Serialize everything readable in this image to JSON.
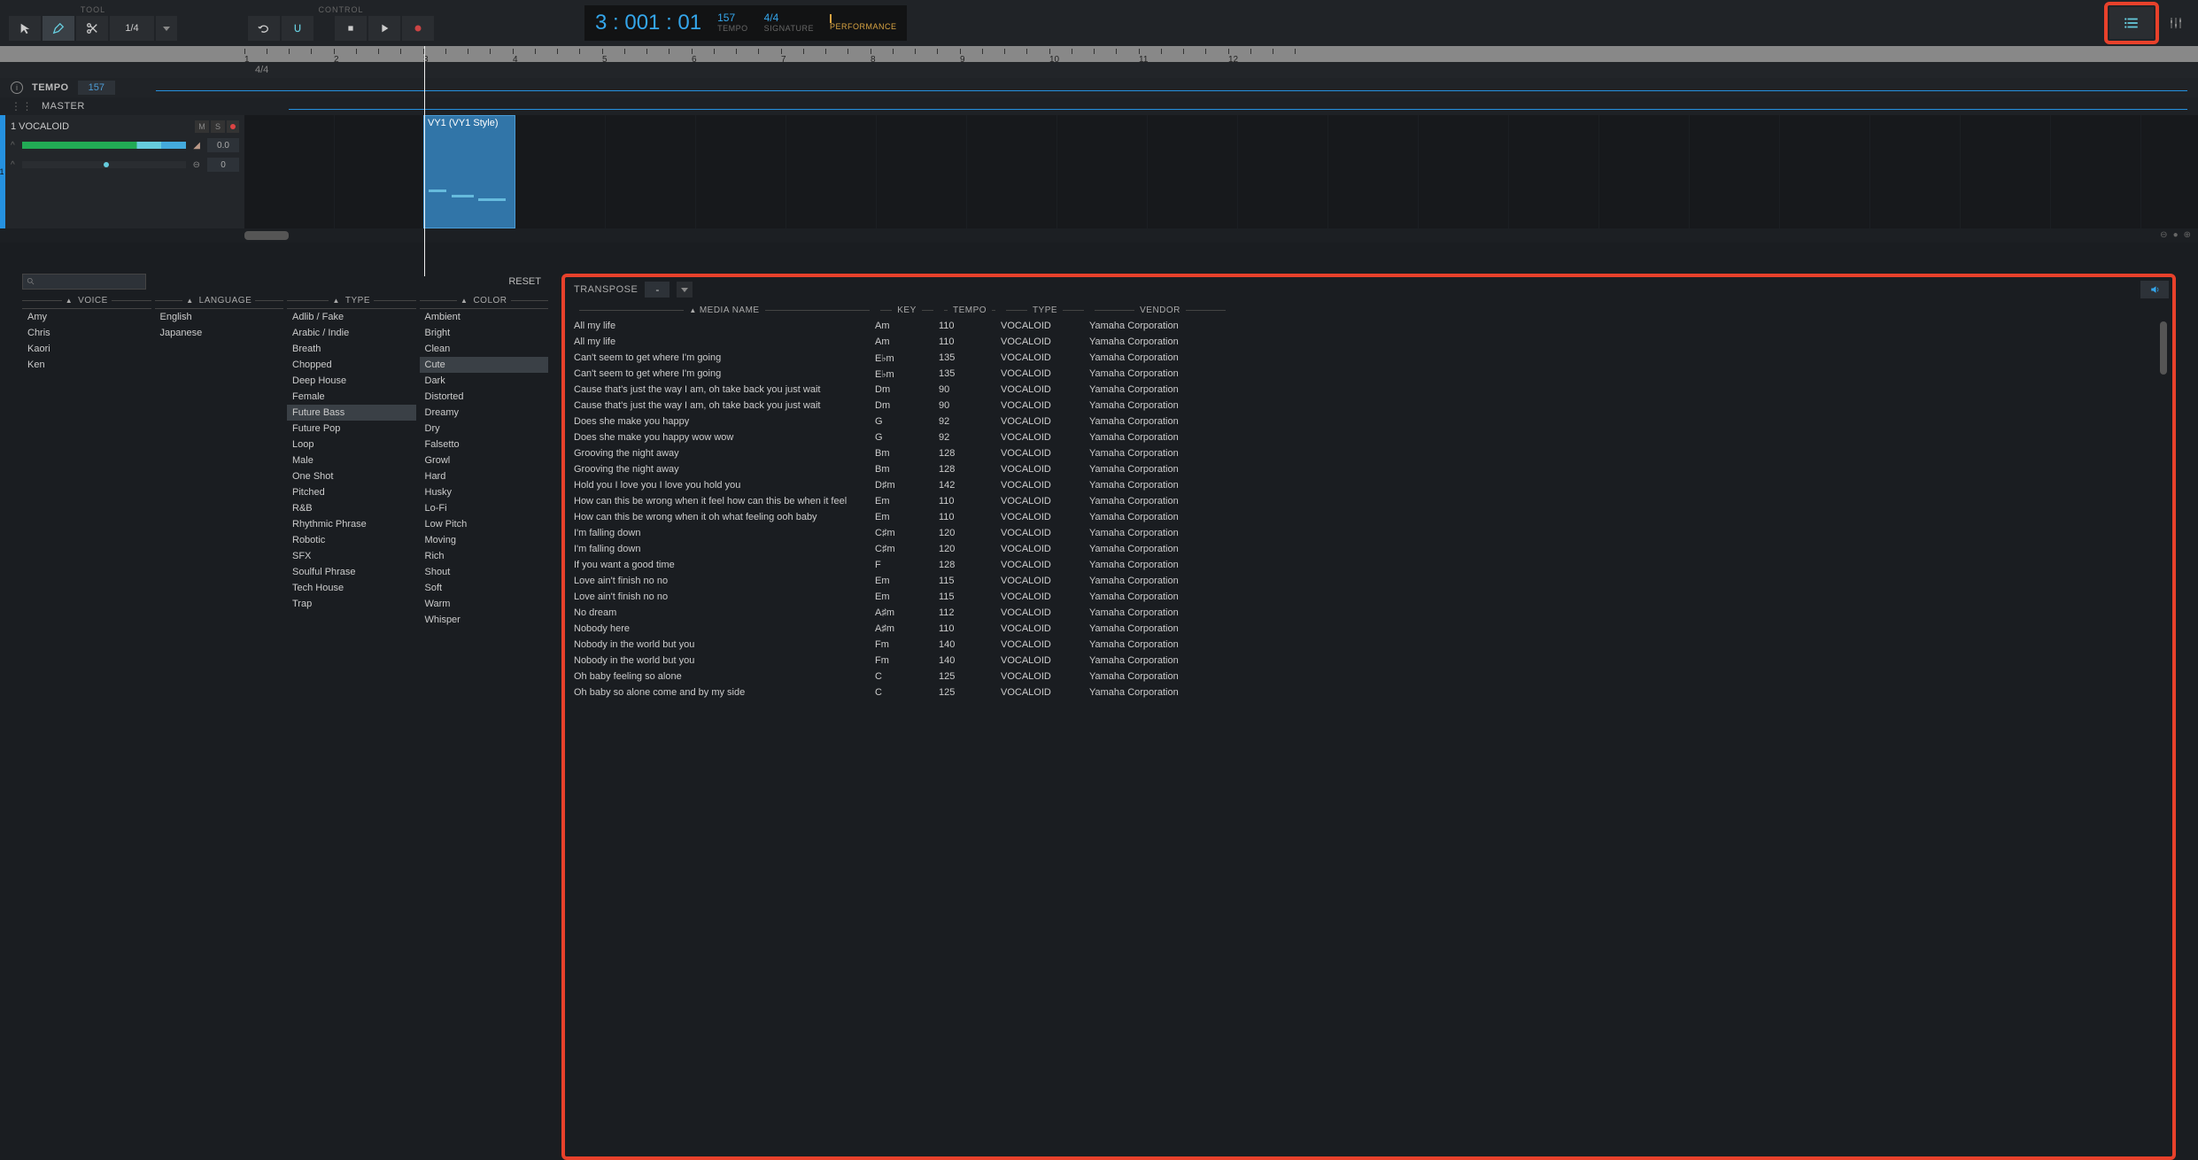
{
  "toolbar": {
    "tool_label": "TOOL",
    "control_label": "CONTROL",
    "fraction": "1/4"
  },
  "transport": {
    "time": "3 : 001 : 01",
    "tempo_val": "157",
    "tempo_label": "TEMPO",
    "sig_val": "4/4",
    "sig_label": "SIGNATURE",
    "perf_label": "PERFORMANCE"
  },
  "sig_row": "4/4",
  "tempo_row": {
    "label": "TEMPO",
    "value": "157"
  },
  "master_row": {
    "label": "MASTER"
  },
  "track": {
    "num": "1",
    "name": "1 VOCALOID",
    "m": "M",
    "s": "S",
    "vol": "0.0",
    "pan": "0",
    "clip_label": "VY1 (VY1 Style)"
  },
  "reset": "RESET",
  "filters": {
    "voice": {
      "header": "VOICE",
      "items": [
        "Amy",
        "Chris",
        "Kaori",
        "Ken"
      ]
    },
    "language": {
      "header": "LANGUAGE",
      "items": [
        "English",
        "Japanese"
      ]
    },
    "type": {
      "header": "TYPE",
      "items": [
        "Adlib / Fake",
        "Arabic / Indie",
        "Breath",
        "Chopped",
        "Deep House",
        "Female",
        "Future Bass",
        "Future Pop",
        "Loop",
        "Male",
        "One Shot",
        "Pitched",
        "R&B",
        "Rhythmic Phrase",
        "Robotic",
        "SFX",
        "Soulful Phrase",
        "Tech House",
        "Trap"
      ],
      "selected": "Future Bass"
    },
    "color": {
      "header": "COLOR",
      "items": [
        "Ambient",
        "Bright",
        "Clean",
        "Cute",
        "Dark",
        "Distorted",
        "Dreamy",
        "Dry",
        "Falsetto",
        "Growl",
        "Hard",
        "Husky",
        "Lo-Fi",
        "Low Pitch",
        "Moving",
        "Rich",
        "Shout",
        "Soft",
        "Warm",
        "Whisper"
      ],
      "selected": "Cute"
    }
  },
  "media": {
    "transpose_label": "TRANSPOSE",
    "transpose_val": "-",
    "headers": {
      "name": "MEDIA NAME",
      "key": "KEY",
      "tempo": "TEMPO",
      "type": "TYPE",
      "vendor": "VENDOR"
    },
    "rows": [
      {
        "name": "All my life",
        "key": "Am",
        "tempo": "110",
        "type": "VOCALOID",
        "vendor": "Yamaha Corporation"
      },
      {
        "name": "All my life",
        "key": "Am",
        "tempo": "110",
        "type": "VOCALOID",
        "vendor": "Yamaha Corporation"
      },
      {
        "name": "Can't seem to get where I'm going",
        "key": "E♭m",
        "tempo": "135",
        "type": "VOCALOID",
        "vendor": "Yamaha Corporation"
      },
      {
        "name": "Can't seem to get where I'm going",
        "key": "E♭m",
        "tempo": "135",
        "type": "VOCALOID",
        "vendor": "Yamaha Corporation"
      },
      {
        "name": "Cause that's just the way I am, oh take back you just wait",
        "key": "Dm",
        "tempo": "90",
        "type": "VOCALOID",
        "vendor": "Yamaha Corporation"
      },
      {
        "name": "Cause that's just the way I am, oh take back you just wait",
        "key": "Dm",
        "tempo": "90",
        "type": "VOCALOID",
        "vendor": "Yamaha Corporation"
      },
      {
        "name": "Does she make you happy",
        "key": "G",
        "tempo": "92",
        "type": "VOCALOID",
        "vendor": "Yamaha Corporation"
      },
      {
        "name": "Does she make you happy wow wow",
        "key": "G",
        "tempo": "92",
        "type": "VOCALOID",
        "vendor": "Yamaha Corporation"
      },
      {
        "name": "Grooving the night away",
        "key": "Bm",
        "tempo": "128",
        "type": "VOCALOID",
        "vendor": "Yamaha Corporation"
      },
      {
        "name": "Grooving the night away",
        "key": "Bm",
        "tempo": "128",
        "type": "VOCALOID",
        "vendor": "Yamaha Corporation"
      },
      {
        "name": "Hold you I love you I love you hold you",
        "key": "D♯m",
        "tempo": "142",
        "type": "VOCALOID",
        "vendor": "Yamaha Corporation"
      },
      {
        "name": "How can this be wrong when it feel how can this be when it feel",
        "key": "Em",
        "tempo": "110",
        "type": "VOCALOID",
        "vendor": "Yamaha Corporation"
      },
      {
        "name": "How can this be wrong when it oh what feeling ooh baby",
        "key": "Em",
        "tempo": "110",
        "type": "VOCALOID",
        "vendor": "Yamaha Corporation"
      },
      {
        "name": "I'm falling down",
        "key": "C♯m",
        "tempo": "120",
        "type": "VOCALOID",
        "vendor": "Yamaha Corporation"
      },
      {
        "name": "I'm falling down",
        "key": "C♯m",
        "tempo": "120",
        "type": "VOCALOID",
        "vendor": "Yamaha Corporation"
      },
      {
        "name": "If you want a good time",
        "key": "F",
        "tempo": "128",
        "type": "VOCALOID",
        "vendor": "Yamaha Corporation"
      },
      {
        "name": "Love ain't finish no no",
        "key": "Em",
        "tempo": "115",
        "type": "VOCALOID",
        "vendor": "Yamaha Corporation"
      },
      {
        "name": "Love ain't finish no no",
        "key": "Em",
        "tempo": "115",
        "type": "VOCALOID",
        "vendor": "Yamaha Corporation"
      },
      {
        "name": "No dream",
        "key": "A♯m",
        "tempo": "112",
        "type": "VOCALOID",
        "vendor": "Yamaha Corporation"
      },
      {
        "name": "Nobody here",
        "key": "A♯m",
        "tempo": "110",
        "type": "VOCALOID",
        "vendor": "Yamaha Corporation"
      },
      {
        "name": "Nobody in the world but you",
        "key": "Fm",
        "tempo": "140",
        "type": "VOCALOID",
        "vendor": "Yamaha Corporation"
      },
      {
        "name": "Nobody in the world but you",
        "key": "Fm",
        "tempo": "140",
        "type": "VOCALOID",
        "vendor": "Yamaha Corporation"
      },
      {
        "name": "Oh baby feeling so alone",
        "key": "C",
        "tempo": "125",
        "type": "VOCALOID",
        "vendor": "Yamaha Corporation"
      },
      {
        "name": "Oh baby so alone come and by my side",
        "key": "C",
        "tempo": "125",
        "type": "VOCALOID",
        "vendor": "Yamaha Corporation"
      }
    ]
  },
  "timeline_marks": [
    "1",
    "2",
    "3",
    "4",
    "5",
    "6",
    "7",
    "8",
    "9",
    "10",
    "11",
    "12"
  ]
}
